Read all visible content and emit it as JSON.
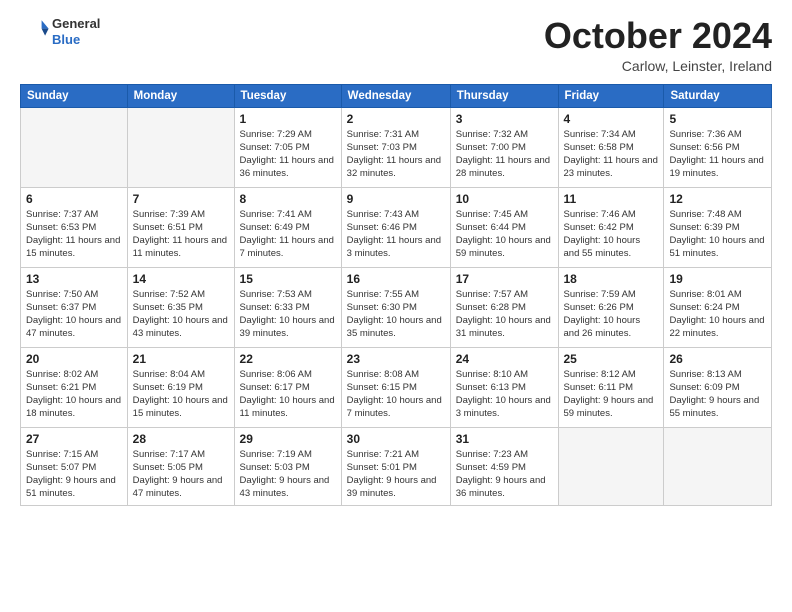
{
  "header": {
    "logo_general": "General",
    "logo_blue": "Blue",
    "month_title": "October 2024",
    "location": "Carlow, Leinster, Ireland"
  },
  "weekdays": [
    "Sunday",
    "Monday",
    "Tuesday",
    "Wednesday",
    "Thursday",
    "Friday",
    "Saturday"
  ],
  "weeks": [
    [
      {
        "day": "",
        "empty": true
      },
      {
        "day": "",
        "empty": true
      },
      {
        "day": "1",
        "sunrise": "7:29 AM",
        "sunset": "7:05 PM",
        "daylight": "11 hours and 36 minutes."
      },
      {
        "day": "2",
        "sunrise": "7:31 AM",
        "sunset": "7:03 PM",
        "daylight": "11 hours and 32 minutes."
      },
      {
        "day": "3",
        "sunrise": "7:32 AM",
        "sunset": "7:00 PM",
        "daylight": "11 hours and 28 minutes."
      },
      {
        "day": "4",
        "sunrise": "7:34 AM",
        "sunset": "6:58 PM",
        "daylight": "11 hours and 23 minutes."
      },
      {
        "day": "5",
        "sunrise": "7:36 AM",
        "sunset": "6:56 PM",
        "daylight": "11 hours and 19 minutes."
      }
    ],
    [
      {
        "day": "6",
        "sunrise": "7:37 AM",
        "sunset": "6:53 PM",
        "daylight": "11 hours and 15 minutes."
      },
      {
        "day": "7",
        "sunrise": "7:39 AM",
        "sunset": "6:51 PM",
        "daylight": "11 hours and 11 minutes."
      },
      {
        "day": "8",
        "sunrise": "7:41 AM",
        "sunset": "6:49 PM",
        "daylight": "11 hours and 7 minutes."
      },
      {
        "day": "9",
        "sunrise": "7:43 AM",
        "sunset": "6:46 PM",
        "daylight": "11 hours and 3 minutes."
      },
      {
        "day": "10",
        "sunrise": "7:45 AM",
        "sunset": "6:44 PM",
        "daylight": "10 hours and 59 minutes."
      },
      {
        "day": "11",
        "sunrise": "7:46 AM",
        "sunset": "6:42 PM",
        "daylight": "10 hours and 55 minutes."
      },
      {
        "day": "12",
        "sunrise": "7:48 AM",
        "sunset": "6:39 PM",
        "daylight": "10 hours and 51 minutes."
      }
    ],
    [
      {
        "day": "13",
        "sunrise": "7:50 AM",
        "sunset": "6:37 PM",
        "daylight": "10 hours and 47 minutes."
      },
      {
        "day": "14",
        "sunrise": "7:52 AM",
        "sunset": "6:35 PM",
        "daylight": "10 hours and 43 minutes."
      },
      {
        "day": "15",
        "sunrise": "7:53 AM",
        "sunset": "6:33 PM",
        "daylight": "10 hours and 39 minutes."
      },
      {
        "day": "16",
        "sunrise": "7:55 AM",
        "sunset": "6:30 PM",
        "daylight": "10 hours and 35 minutes."
      },
      {
        "day": "17",
        "sunrise": "7:57 AM",
        "sunset": "6:28 PM",
        "daylight": "10 hours and 31 minutes."
      },
      {
        "day": "18",
        "sunrise": "7:59 AM",
        "sunset": "6:26 PM",
        "daylight": "10 hours and 26 minutes."
      },
      {
        "day": "19",
        "sunrise": "8:01 AM",
        "sunset": "6:24 PM",
        "daylight": "10 hours and 22 minutes."
      }
    ],
    [
      {
        "day": "20",
        "sunrise": "8:02 AM",
        "sunset": "6:21 PM",
        "daylight": "10 hours and 18 minutes."
      },
      {
        "day": "21",
        "sunrise": "8:04 AM",
        "sunset": "6:19 PM",
        "daylight": "10 hours and 15 minutes."
      },
      {
        "day": "22",
        "sunrise": "8:06 AM",
        "sunset": "6:17 PM",
        "daylight": "10 hours and 11 minutes."
      },
      {
        "day": "23",
        "sunrise": "8:08 AM",
        "sunset": "6:15 PM",
        "daylight": "10 hours and 7 minutes."
      },
      {
        "day": "24",
        "sunrise": "8:10 AM",
        "sunset": "6:13 PM",
        "daylight": "10 hours and 3 minutes."
      },
      {
        "day": "25",
        "sunrise": "8:12 AM",
        "sunset": "6:11 PM",
        "daylight": "9 hours and 59 minutes."
      },
      {
        "day": "26",
        "sunrise": "8:13 AM",
        "sunset": "6:09 PM",
        "daylight": "9 hours and 55 minutes."
      }
    ],
    [
      {
        "day": "27",
        "sunrise": "7:15 AM",
        "sunset": "5:07 PM",
        "daylight": "9 hours and 51 minutes."
      },
      {
        "day": "28",
        "sunrise": "7:17 AM",
        "sunset": "5:05 PM",
        "daylight": "9 hours and 47 minutes."
      },
      {
        "day": "29",
        "sunrise": "7:19 AM",
        "sunset": "5:03 PM",
        "daylight": "9 hours and 43 minutes."
      },
      {
        "day": "30",
        "sunrise": "7:21 AM",
        "sunset": "5:01 PM",
        "daylight": "9 hours and 39 minutes."
      },
      {
        "day": "31",
        "sunrise": "7:23 AM",
        "sunset": "4:59 PM",
        "daylight": "9 hours and 36 minutes."
      },
      {
        "day": "",
        "empty": true
      },
      {
        "day": "",
        "empty": true
      }
    ]
  ],
  "labels": {
    "sunrise": "Sunrise:",
    "sunset": "Sunset:",
    "daylight": "Daylight:"
  }
}
